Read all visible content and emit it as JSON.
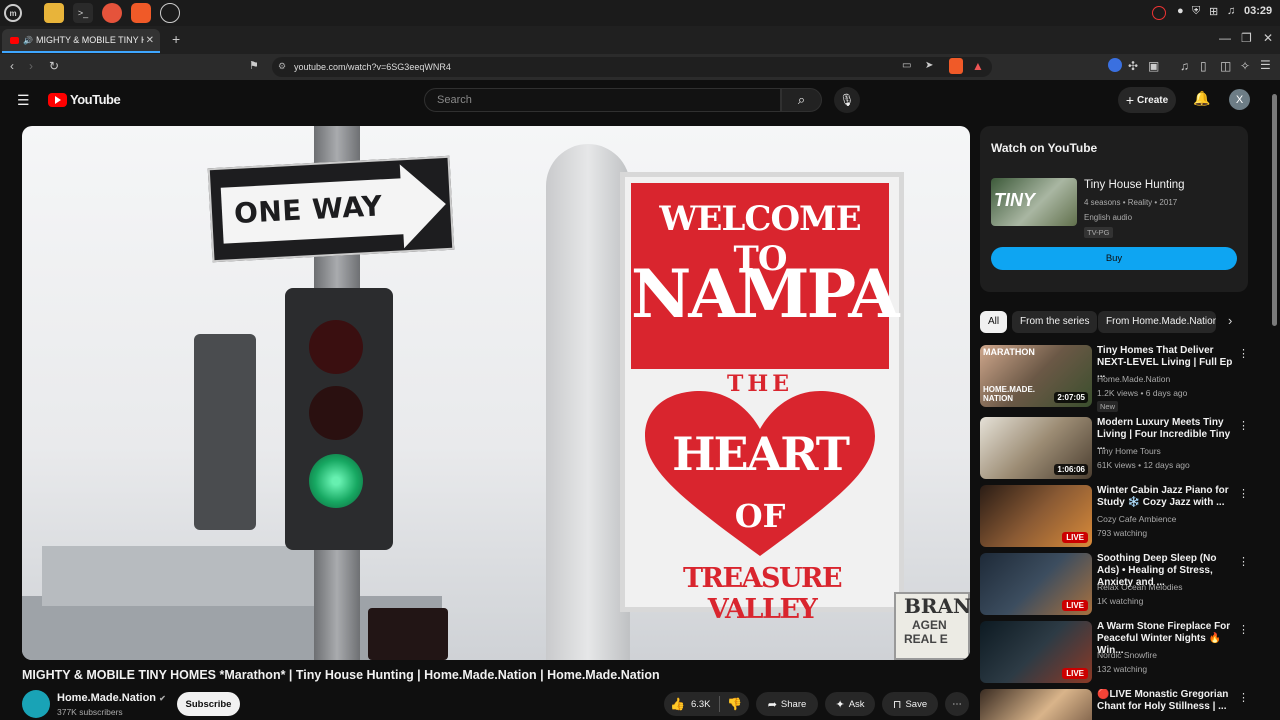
{
  "os": {
    "clock": "03:29",
    "apps": [
      "mint-menu-icon",
      "files-icon",
      "terminal-icon",
      "firefox-icon",
      "brave-icon",
      "chrome-icon"
    ]
  },
  "browser": {
    "tab_title": "MIGHTY & MOBILE TINY H...",
    "url": "youtube.com/watch?v=6SG3eeqWNR4",
    "new_tab": "+"
  },
  "youtube": {
    "logo_text": "YouTube",
    "search_placeholder": "Search",
    "create_label": "Create",
    "avatar_letter": "X"
  },
  "video": {
    "sign_one_way": "ONE WAY",
    "sign_welcome": "WELCOME TO",
    "sign_city": "NAMPA",
    "sign_the": "THE",
    "sign_heart": "HEART",
    "sign_of": "OF",
    "sign_valley": "TREASURE VALLEY",
    "sign_brand_1": "BRAN",
    "sign_brand_2": "AGEN",
    "sign_brand_3": "REAL E",
    "title": "MIGHTY & MOBILE TINY HOMES *Marathon* | Tiny House Hunting | Home.Made.Nation | Home.Made.Nation",
    "channel": "Home.Made.Nation",
    "subscribers": "377K subscribers",
    "subscribe_label": "Subscribe",
    "likes": "6.3K",
    "share_label": "Share",
    "ask_label": "Ask",
    "save_label": "Save"
  },
  "watch_card": {
    "heading": "Watch on YouTube",
    "show_title": "Tiny House Hunting",
    "show_meta": "4 seasons • Reality • 2017",
    "audio": "English audio",
    "rating": "TV-PG",
    "buy_label": "Buy",
    "thumb_text": "TINY"
  },
  "chips": [
    "All",
    "From the series",
    "From Home.Made.Nation"
  ],
  "recommendations": [
    {
      "title": "Tiny Homes That Deliver NEXT-LEVEL Living | Full Ep ...",
      "channel": "Home.Made.Nation",
      "meta": "1.2K views • 6 days ago",
      "badge": "New",
      "duration": "2:07:05",
      "thumb_label": "MARATHON",
      "thumb_label2": "HOME.MADE. NATION"
    },
    {
      "title": "Modern Luxury Meets Tiny Living | Four Incredible Tiny ...",
      "channel": "Tiny Home Tours",
      "meta": "61K views • 12 days ago",
      "duration": "1:06:06"
    },
    {
      "title": "Winter Cabin Jazz Piano for Study ❄️ Cozy Jazz with ...",
      "channel": "Cozy Cafe Ambience",
      "meta": "793 watching",
      "live": "LIVE"
    },
    {
      "title": "Soothing Deep Sleep (No Ads) • Healing of Stress, Anxiety and ...",
      "channel": "Relax Ocean Melodies",
      "meta": "1K watching",
      "live": "LIVE"
    },
    {
      "title": "A Warm Stone Fireplace For Peaceful Winter Nights 🔥Win...",
      "channel": "Nordic Snowfire",
      "meta": "132 watching",
      "live": "LIVE"
    },
    {
      "title": "🔴LIVE Monastic Gregorian Chant for Holy Stillness | ...",
      "channel": "",
      "meta": ""
    }
  ]
}
